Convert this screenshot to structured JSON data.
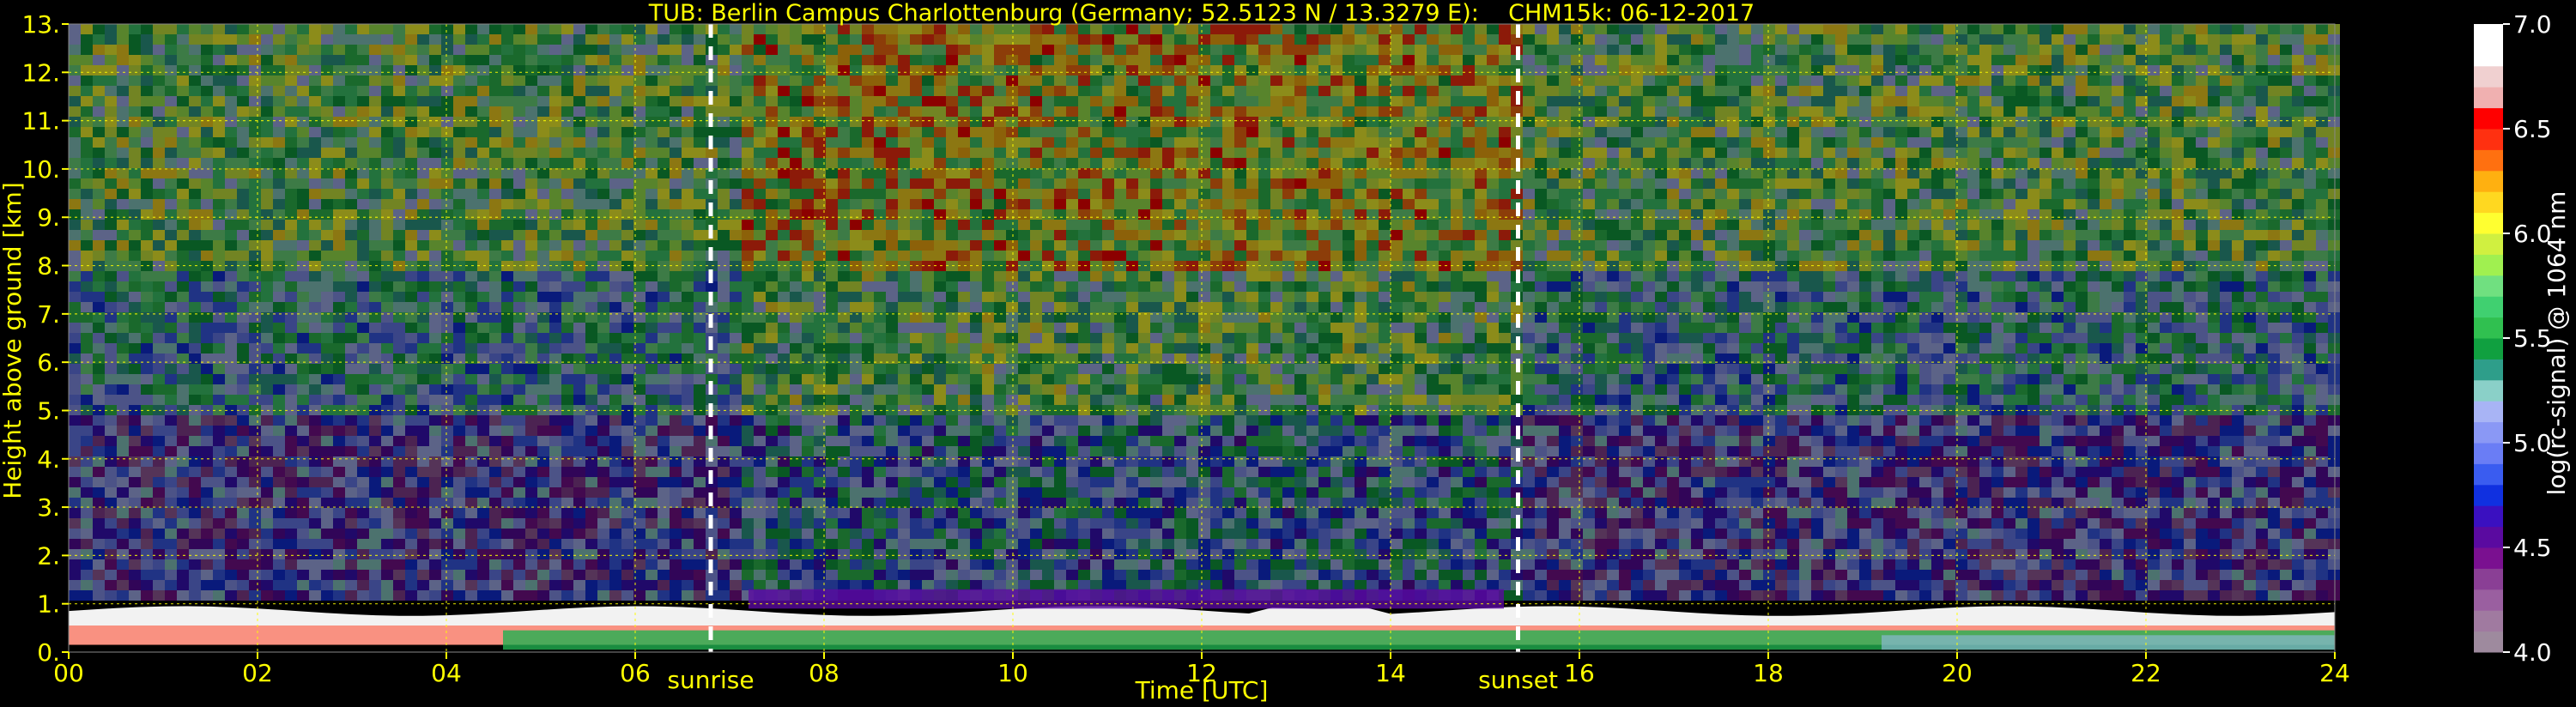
{
  "chart_data": {
    "type": "heatmap",
    "title": "TUB: Berlin Campus Charlottenburg (Germany; 52.5123 N / 13.3279 E):    CHM15k: 06-12-2017",
    "xlabel": "Time [UTC]",
    "ylabel": "Height above ground [km]",
    "xlim": [
      0,
      24
    ],
    "ylim": [
      0,
      13
    ],
    "x_ticks": [
      {
        "value": 0,
        "label": "00"
      },
      {
        "value": 2,
        "label": "02"
      },
      {
        "value": 4,
        "label": "04"
      },
      {
        "value": 6,
        "label": "06"
      },
      {
        "value": 8,
        "label": "08"
      },
      {
        "value": 10,
        "label": "10"
      },
      {
        "value": 12,
        "label": "12"
      },
      {
        "value": 14,
        "label": "14"
      },
      {
        "value": 16,
        "label": "16"
      },
      {
        "value": 18,
        "label": "18"
      },
      {
        "value": 20,
        "label": "20"
      },
      {
        "value": 22,
        "label": "22"
      },
      {
        "value": 24,
        "label": "24"
      }
    ],
    "y_ticks": [
      {
        "value": 0,
        "label": "0."
      },
      {
        "value": 1,
        "label": "1."
      },
      {
        "value": 2,
        "label": "2."
      },
      {
        "value": 3,
        "label": "3."
      },
      {
        "value": 4,
        "label": "4."
      },
      {
        "value": 5,
        "label": "5."
      },
      {
        "value": 6,
        "label": "6."
      },
      {
        "value": 7,
        "label": "7."
      },
      {
        "value": 8,
        "label": "8."
      },
      {
        "value": 9,
        "label": "9."
      },
      {
        "value": 10,
        "label": "10."
      },
      {
        "value": 11,
        "label": "11."
      },
      {
        "value": 12,
        "label": "12."
      },
      {
        "value": 13,
        "label": "13."
      }
    ],
    "grid": true,
    "annotations": [
      {
        "label": "sunrise",
        "x": 6.8
      },
      {
        "label": "sunset",
        "x": 15.35
      }
    ],
    "colorbar": {
      "label": "log(rc-signal) @ 1064 nm",
      "range": [
        4.0,
        7.0
      ],
      "ticks": [
        {
          "value": 4.0,
          "label": "4.0"
        },
        {
          "value": 4.5,
          "label": "4.5"
        },
        {
          "value": 5.0,
          "label": "5.0"
        },
        {
          "value": 5.5,
          "label": "5.5"
        },
        {
          "value": 6.0,
          "label": "6.0"
        },
        {
          "value": 6.5,
          "label": "6.5"
        },
        {
          "value": 7.0,
          "label": "7.0"
        }
      ],
      "colors": [
        "#9e8a9e",
        "#a07aa0",
        "#9a5fa0",
        "#8a3f95",
        "#7a1090",
        "#5a0aa0",
        "#3a10c0",
        "#1030e0",
        "#3a5cf0",
        "#6a7df5",
        "#8a98f5",
        "#a8b4f5",
        "#8ad0c8",
        "#2e9e8a",
        "#10a040",
        "#30c050",
        "#40d070",
        "#70e080",
        "#a0f050",
        "#d0f040",
        "#ffff30",
        "#ffd820",
        "#ffb010",
        "#ff7010",
        "#ff3010",
        "#ff0000",
        "#f0b0b0",
        "#f0d0d0",
        "#ffffff",
        "#ffffff"
      ]
    }
  }
}
